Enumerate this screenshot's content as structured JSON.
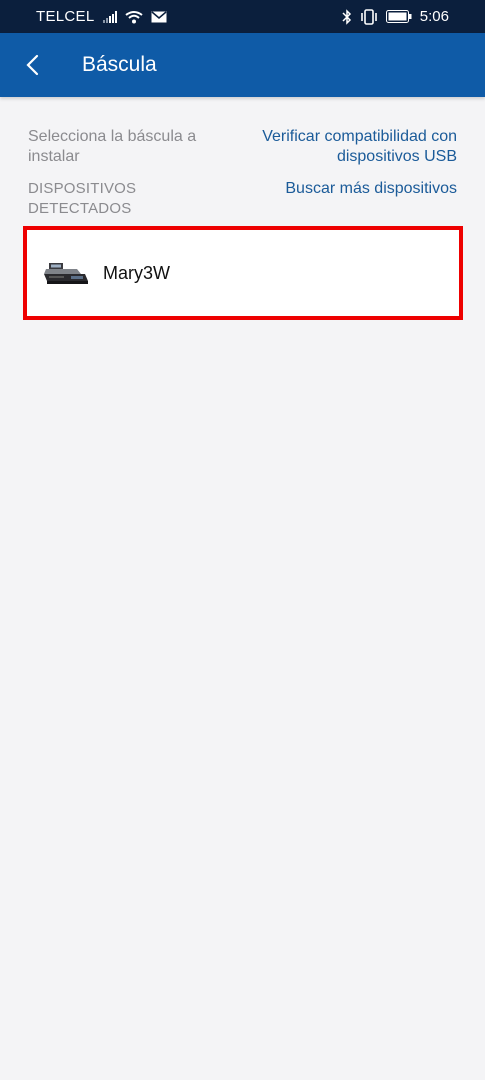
{
  "status_bar": {
    "carrier": "TELCEL",
    "time": "5:06",
    "icons": [
      "signal-icon",
      "wifi-icon",
      "mail-icon",
      "bluetooth-icon",
      "vibrate-icon",
      "battery-icon"
    ]
  },
  "app_bar": {
    "title": "Báscula",
    "back_icon": "chevron-left-icon",
    "background": "#0f5ba7"
  },
  "main": {
    "hint": "Selecciona la báscula a instalar",
    "verify_link": "Verificar compatibilidad con dispositivos USB",
    "section_label": "DISPOSITIVOS DETECTADOS",
    "search_link": "Buscar más dispositivos",
    "link_color": "#1b5b99",
    "devices": [
      {
        "name": "Mary3W",
        "icon": "scale-icon"
      }
    ]
  }
}
